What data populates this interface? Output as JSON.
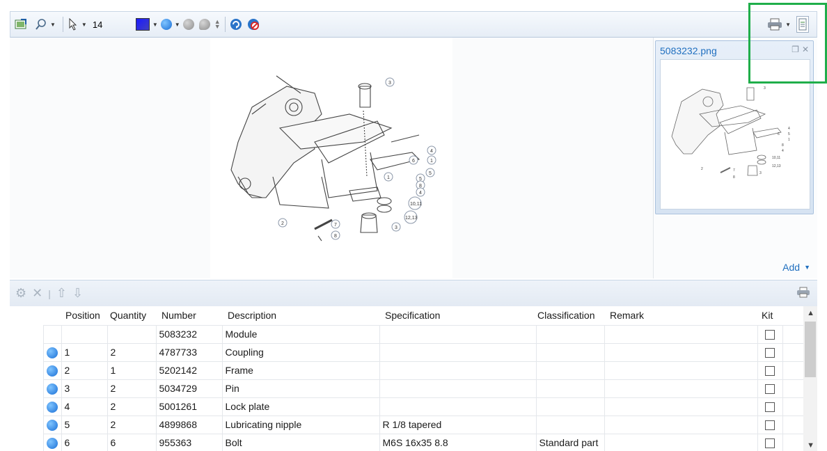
{
  "toolbar": {
    "font_size_value": "14",
    "color_swatch": "#2a2ae6"
  },
  "thumbnail": {
    "title": "5083232.png",
    "add_label": "Add"
  },
  "drawing": {
    "callouts": [
      "3",
      "4",
      "1",
      "5",
      "6",
      "5",
      "8",
      "4",
      "1",
      "10,11",
      "12,13",
      "3",
      "7",
      "8",
      "2"
    ]
  },
  "thumb_drawing": {
    "callouts": [
      "3",
      "4",
      "5",
      "1",
      "6",
      "8",
      "4",
      "10,11",
      "12,13",
      "3",
      "2",
      "7",
      "8"
    ]
  },
  "table": {
    "columns": [
      "Position",
      "Quantity",
      "Number",
      "Description",
      "Specification",
      "Classification",
      "Remark",
      "Kit"
    ],
    "rows": [
      {
        "dot": false,
        "position": "",
        "quantity": "",
        "number": "5083232",
        "description": "Module",
        "specification": "",
        "classification": "",
        "remark": ""
      },
      {
        "dot": true,
        "position": "1",
        "quantity": "2",
        "number": "4787733",
        "description": "Coupling",
        "specification": "",
        "classification": "",
        "remark": ""
      },
      {
        "dot": true,
        "position": "2",
        "quantity": "1",
        "number": "5202142",
        "description": "Frame",
        "specification": "",
        "classification": "",
        "remark": ""
      },
      {
        "dot": true,
        "position": "3",
        "quantity": "2",
        "number": "5034729",
        "description": "Pin",
        "specification": "",
        "classification": "",
        "remark": ""
      },
      {
        "dot": true,
        "position": "4",
        "quantity": "2",
        "number": "5001261",
        "description": "Lock plate",
        "specification": "",
        "classification": "",
        "remark": ""
      },
      {
        "dot": true,
        "position": "5",
        "quantity": "2",
        "number": "4899868",
        "description": "Lubricating nipple",
        "specification": "R 1/8 tapered",
        "classification": "",
        "remark": ""
      },
      {
        "dot": true,
        "position": "6",
        "quantity": "6",
        "number": "955363",
        "description": "Bolt",
        "specification": "M6S  16x35  8.8",
        "classification": "Standard part",
        "remark": ""
      }
    ]
  },
  "colors": {
    "accent": "#1f6fbf",
    "highlight": "#1fae4a",
    "row_dot": "#1a6fd6"
  }
}
